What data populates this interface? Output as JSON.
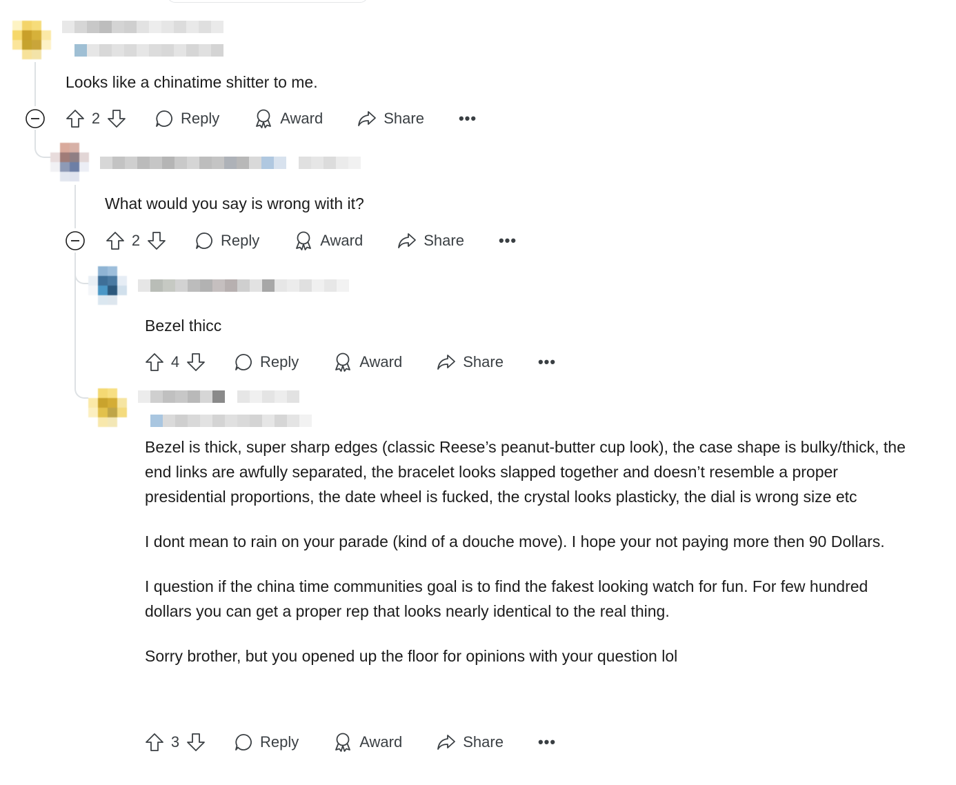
{
  "comments": [
    {
      "id": "c1",
      "text": [
        "Looks like a chinatime shitter to me."
      ],
      "votes": "2",
      "reply": "Reply",
      "award": "Award",
      "share": "Share",
      "more": "•••"
    },
    {
      "id": "c2",
      "text": [
        "What would you say is wrong with it?"
      ],
      "votes": "2",
      "reply": "Reply",
      "award": "Award",
      "share": "Share",
      "more": "•••"
    },
    {
      "id": "c3",
      "text": [
        "Bezel thicc"
      ],
      "votes": "4",
      "reply": "Reply",
      "award": "Award",
      "share": "Share",
      "more": "•••"
    },
    {
      "id": "c4",
      "text": [
        "Bezel is thick, super sharp edges (classic Reese’s peanut-butter cup look), the case shape is bulky/thick, the end links are awfully separated, the bracelet looks slapped together and doesn’t resemble a proper presidential proportions, the date wheel is fucked, the crystal looks plasticky, the dial is wrong size etc",
        "I dont mean to rain on your parade (kind of a douche move). I hope your not paying more then 90 Dollars.",
        "I question if the china time communities goal is to find the fakest looking watch for fun. For few hundred dollars you can get a proper rep that looks nearly identical to the real thing.",
        "Sorry brother, but you opened up the floor for opinions with your question lol"
      ],
      "votes": "3",
      "reply": "Reply",
      "award": "Award",
      "share": "Share",
      "more": "•••"
    }
  ],
  "colors": {
    "text": "#1c1c1c",
    "icon": "#3a3f43",
    "thread_line": "#dde1e4"
  },
  "icons": [
    "upvote-icon",
    "downvote-icon",
    "reply-bubble-icon",
    "award-icon",
    "share-arrow-icon",
    "more-icon",
    "collapse-minus-icon"
  ]
}
